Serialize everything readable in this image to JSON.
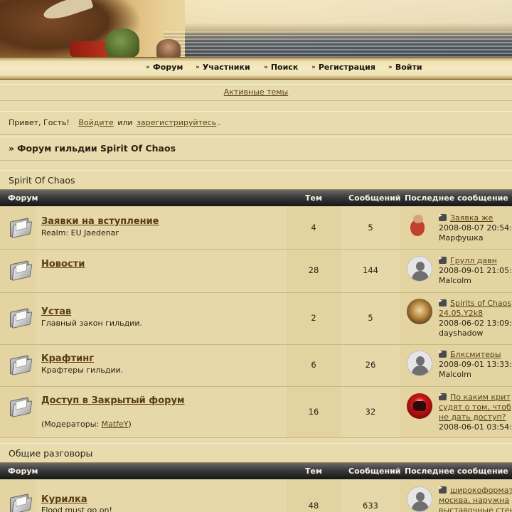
{
  "nav": {
    "items": [
      {
        "label": "Форум",
        "icon": "double-chevron-icon"
      },
      {
        "label": "Участники",
        "icon": "double-chevron-icon"
      },
      {
        "label": "Поиск",
        "icon": "double-chevron-icon"
      },
      {
        "label": "Регистрация",
        "icon": "double-chevron-icon"
      },
      {
        "label": "Войти",
        "icon": "double-chevron-icon"
      }
    ]
  },
  "active_topics": "Активные темы",
  "greeting": {
    "prefix": "Привет, Гость!",
    "login_link": "Войдите",
    "or": "или",
    "register_link": "зарегистрируйтесь",
    "suffix": "."
  },
  "breadcrumb": {
    "raquo": "»",
    "title": "Форум гильдии Spirit Of Chaos"
  },
  "table_headers": {
    "forum": "Форум",
    "topics": "Тем",
    "posts": "Сообщений",
    "last": "Последнее сообщение"
  },
  "categories": [
    {
      "title": "Spirit Of Chaos",
      "forums": [
        {
          "name": "Заявки на вступление",
          "desc": "Realm: EU Jaedenar",
          "topics": "4",
          "posts": "5",
          "avatar": "dwarf-avatar",
          "last_title": "Заявка же",
          "last_date": "2008-08-07 20:54:",
          "last_author": "Марфушка"
        },
        {
          "name": "Новости",
          "desc": "",
          "topics": "28",
          "posts": "144",
          "avatar": "default-avatar",
          "last_title": "Грулл давн",
          "last_date": "2008-09-01 21:05:",
          "last_author": "Malcolm"
        },
        {
          "name": "Устав",
          "desc": "Главный закон гильдии.",
          "topics": "2",
          "posts": "5",
          "avatar": "gold-avatar",
          "last_title_1": "Spirits of Chaos",
          "last_title_2": "24.05.Y2k8",
          "last_date": "2008-06-02 13:09:",
          "last_author": "dayshadow"
        },
        {
          "name": "Крафтинг",
          "desc": "Крафтеры гильдии.",
          "topics": "6",
          "posts": "26",
          "avatar": "default-avatar",
          "last_title": "Блксмитеры",
          "last_date": "2008-09-01 13:33:",
          "last_author": "Malcolm"
        },
        {
          "name": "Доступ в Закрытый форум",
          "desc_prefix": "(Модераторы:",
          "moderator": "MatfeY",
          "desc_suffix": ")",
          "topics": "16",
          "posts": "32",
          "avatar": "red-avatar",
          "last_title_1": "По каким крит",
          "last_title_2": "судят о том, чтоб",
          "last_title_3": "не дать доступ?",
          "last_date": "2008-06-01 03:54:"
        }
      ]
    },
    {
      "title": "Общие разговоры",
      "forums": [
        {
          "name": "Курилка",
          "desc": "Flood must go on!",
          "topics": "48",
          "posts": "633",
          "avatar": "default-avatar",
          "last_title_1": "широкоформат",
          "last_title_2": "москва, наружна",
          "last_title_3": "выставочные стен"
        }
      ]
    }
  ]
}
